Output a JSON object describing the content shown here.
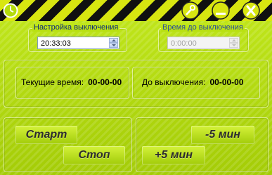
{
  "shutdown_settings": {
    "legend": "Настройка выключения",
    "time_value": "20:33:03"
  },
  "time_until": {
    "legend": "Время до выключения",
    "time_value": "0:00:00",
    "disabled": true
  },
  "status": {
    "current_time_label": "Текущие время:",
    "current_time_value": "00-00-00",
    "until_label": "До выключения:",
    "until_value": "00-00-00"
  },
  "buttons": {
    "start": "Старт",
    "stop": "Стоп",
    "minus5": "-5 мин",
    "plus5": "+5 мин"
  },
  "colors": {
    "accent": "#b4dc0c",
    "titlebar_stripe_light": "#d8e610",
    "titlebar_stripe_dark": "#101010"
  }
}
